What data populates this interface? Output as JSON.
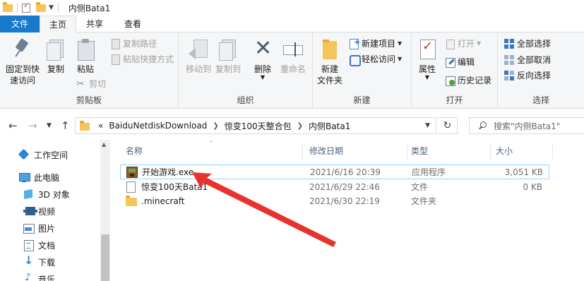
{
  "window": {
    "title": "内侧Bata1"
  },
  "tabs": [
    {
      "label": "文件"
    },
    {
      "label": "主页"
    },
    {
      "label": "共享"
    },
    {
      "label": "查看"
    }
  ],
  "ribbon": {
    "clipboard": {
      "pin_label_line1": "固定到快",
      "pin_label_line2": "速访问",
      "copy_label": "复制",
      "paste_label": "粘贴",
      "copy_path_label": "复制路径",
      "paste_shortcut_label": "粘贴快捷方式",
      "cut_label": "剪切",
      "group_label": "剪贴板"
    },
    "organize": {
      "move_to_label": "移动到",
      "copy_to_label": "复制到",
      "delete_label": "删除",
      "rename_label": "重命名",
      "group_label": "组织"
    },
    "new": {
      "new_folder_line1": "新建",
      "new_folder_line2": "文件夹",
      "new_item_label": "新建项目",
      "easy_access_label": "轻松访问",
      "group_label": "新建"
    },
    "open": {
      "properties_label": "属性",
      "open_label": "打开",
      "edit_label": "编辑",
      "history_label": "历史记录",
      "group_label": "打开"
    },
    "select": {
      "select_all_label": "全部选择",
      "select_none_label": "全部取消",
      "invert_label": "反向选择",
      "group_label": "选择"
    }
  },
  "address": {
    "overflow": "«",
    "crumbs": [
      "BaiduNetdiskDownload",
      "惊变100天整合包",
      "内侧Bata1"
    ],
    "search_placeholder": "搜索\"内侧Bata1\""
  },
  "navpane": {
    "items": [
      {
        "label": "工作空间",
        "icon": "workspace-icon"
      },
      {
        "label": "此电脑",
        "icon": "this-pc-icon"
      },
      {
        "label": "3D 对象",
        "icon": "3d-objects-icon"
      },
      {
        "label": "视频",
        "icon": "video-icon"
      },
      {
        "label": "图片",
        "icon": "pictures-icon"
      },
      {
        "label": "文档",
        "icon": "documents-icon"
      },
      {
        "label": "下载",
        "icon": "downloads-icon"
      },
      {
        "label": "音乐",
        "icon": "music-icon"
      }
    ]
  },
  "filelist": {
    "columns": {
      "name": "名称",
      "modified": "修改日期",
      "type": "类型",
      "size": "大小"
    },
    "rows": [
      {
        "name": "开始游戏.exe",
        "modified": "2021/6/16 20:39",
        "type": "应用程序",
        "size": "3,051 KB",
        "icon": "exe-icon"
      },
      {
        "name": "惊变100天Bata1",
        "modified": "2021/6/29 22:46",
        "type": "文件",
        "size": "0 KB",
        "icon": "file-icon"
      },
      {
        "name": ".minecraft",
        "modified": "2021/6/30 22:19",
        "type": "文件夹",
        "size": "",
        "icon": "folder-icon"
      }
    ]
  },
  "colors": {
    "accent": "#1979ca",
    "annotation_arrow": "#e8322d",
    "selection_border": "#99d1ff",
    "folder": "#f3c55a"
  }
}
